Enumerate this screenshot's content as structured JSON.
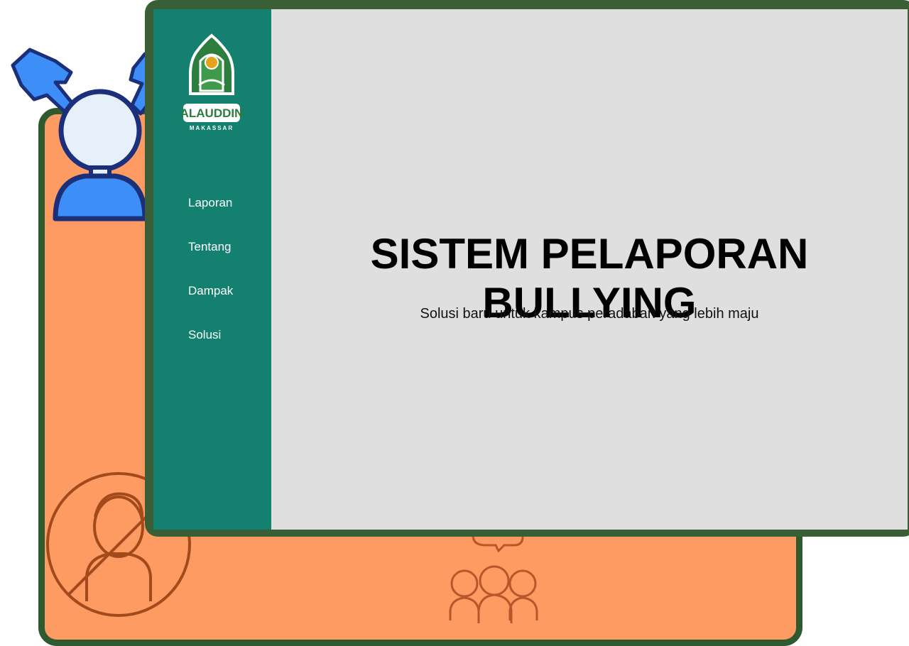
{
  "logo": {
    "name": "ALAUDDIN",
    "subtitle": "MAKASSAR",
    "tagline": "UIN ALAUDDIN MAKASSAR"
  },
  "nav": {
    "items": [
      {
        "label": "Laporan"
      },
      {
        "label": "Tentang"
      },
      {
        "label": "Dampak"
      },
      {
        "label": "Solusi"
      }
    ]
  },
  "hero": {
    "title": "SISTEM PELAPORAN BULLYING",
    "subtitle": "Solusi baru untuk kampus peradaban yang lebih maju"
  },
  "colors": {
    "sidebar": "#138070",
    "main_bg": "#dfdfdf",
    "frame": "#3a5f37",
    "back_card": "#fe9b63"
  },
  "icons": [
    "bullied-person-icon",
    "no-person-icon",
    "complaining-group-icon",
    "logo-emblem-icon"
  ]
}
